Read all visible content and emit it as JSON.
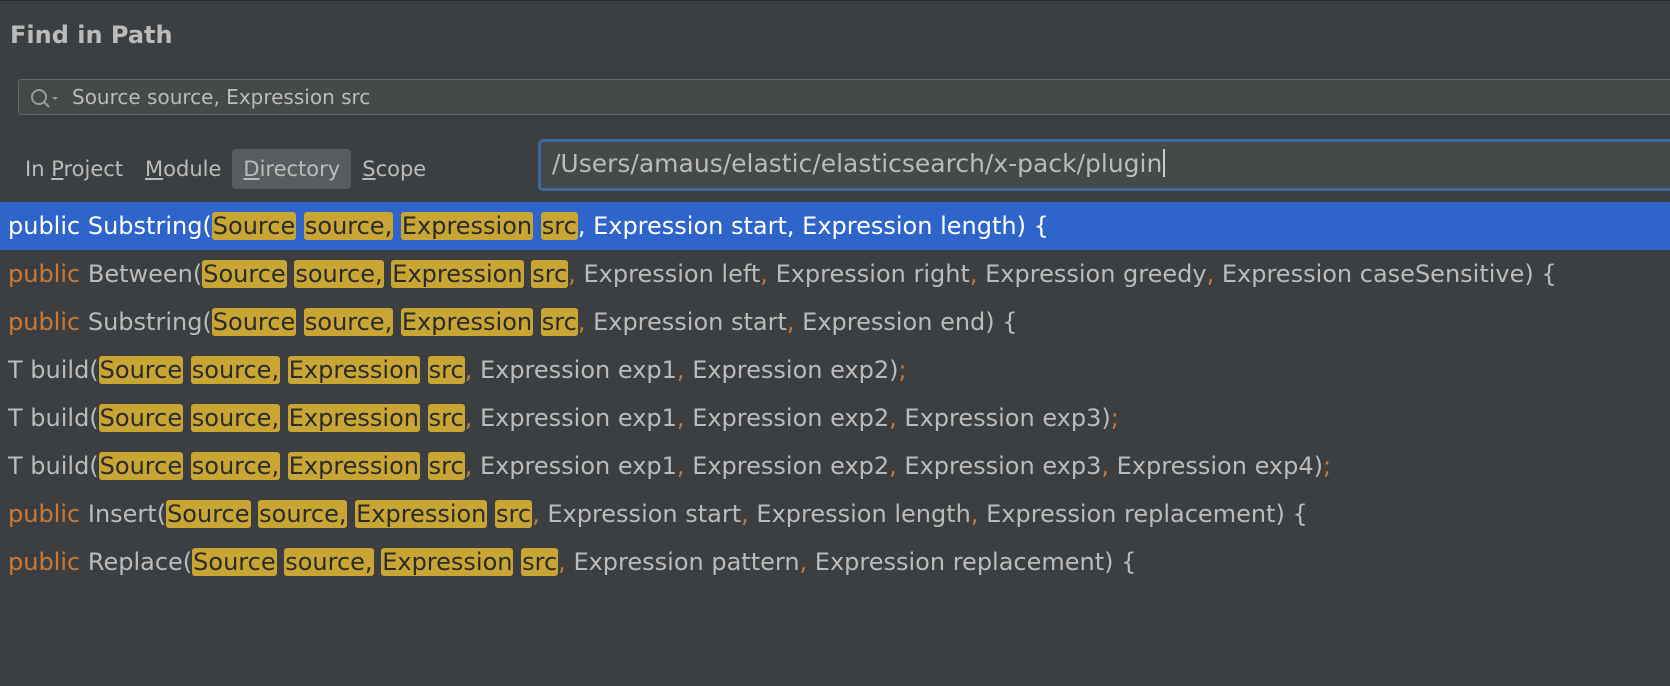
{
  "dialog": {
    "title": "Find in Path"
  },
  "search": {
    "value": "Source source, Expression src",
    "icon": "search-icon"
  },
  "scope_tabs": [
    {
      "before": "In ",
      "mnemonic": "P",
      "after": "roject"
    },
    {
      "before": "",
      "mnemonic": "M",
      "after": "odule"
    },
    {
      "before": "",
      "mnemonic": "D",
      "after": "irectory"
    },
    {
      "before": "",
      "mnemonic": "S",
      "after": "cope"
    }
  ],
  "active_scope": 2,
  "directory": {
    "value": "/Users/amaus/elastic/elasticsearch/x-pack/plugin"
  },
  "results": {
    "selected_index": 0,
    "match": [
      "Source",
      "source",
      ",",
      "Expression",
      "src"
    ],
    "rows": [
      {
        "keyword": "public",
        "prefix": "Substring(",
        "params": [
          "Expression start",
          "Expression length"
        ],
        "suffix": ") {",
        "suffix_colored": false
      },
      {
        "keyword": "public",
        "prefix": "Between(",
        "params": [
          "Expression left",
          "Expression right",
          "Expression greedy",
          "Expression caseSensitive"
        ],
        "suffix": ") {",
        "suffix_colored": false
      },
      {
        "keyword": "public",
        "prefix": "Substring(",
        "params": [
          "Expression start",
          "Expression end"
        ],
        "suffix": ") {",
        "suffix_colored": false
      },
      {
        "keyword": "",
        "prefix": "T build(",
        "params": [
          "Expression exp1",
          "Expression exp2"
        ],
        "suffix": ")",
        "semicolon": ";"
      },
      {
        "keyword": "",
        "prefix": "T build(",
        "params": [
          "Expression exp1",
          "Expression exp2",
          "Expression exp3"
        ],
        "suffix": ")",
        "semicolon": ";"
      },
      {
        "keyword": "",
        "prefix": "T build(",
        "params": [
          "Expression exp1",
          "Expression exp2",
          "Expression exp3",
          "Expression exp4"
        ],
        "suffix": ")",
        "semicolon": ";"
      },
      {
        "keyword": "public",
        "prefix": "Insert(",
        "params": [
          "Expression start",
          "Expression length",
          "Expression replacement"
        ],
        "suffix": ") {",
        "suffix_colored": false
      },
      {
        "keyword": "public",
        "prefix": "Replace(",
        "params": [
          "Expression pattern",
          "Expression replacement"
        ],
        "suffix": ") {",
        "suffix_colored": false
      }
    ]
  }
}
